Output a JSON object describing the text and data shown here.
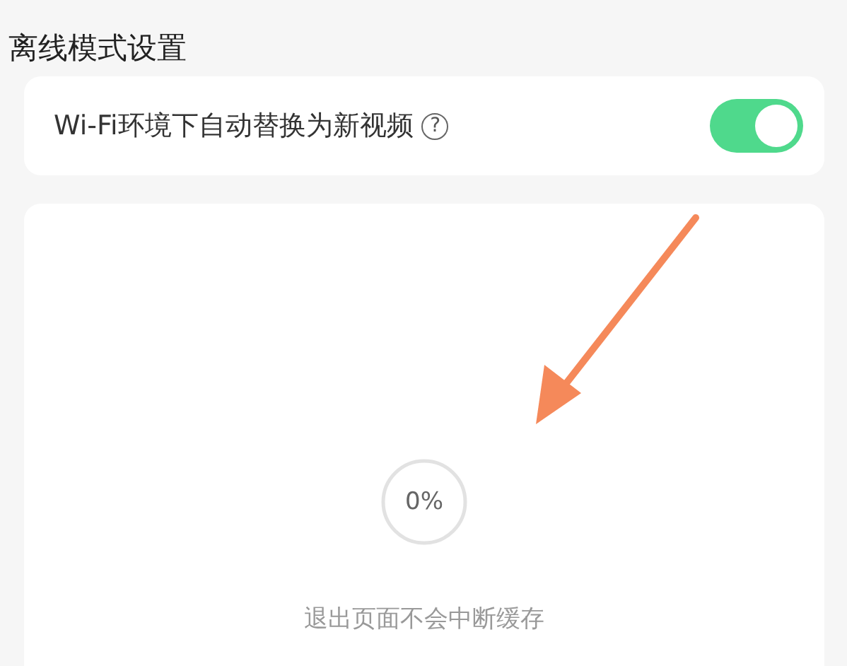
{
  "section_title": "离线模式设置",
  "setting": {
    "label": "Wi-Fi环境下自动替换为新视频",
    "help_icon": "?",
    "on": true
  },
  "download": {
    "percent": "0%",
    "note": "退出页面不会中断缓存"
  }
}
